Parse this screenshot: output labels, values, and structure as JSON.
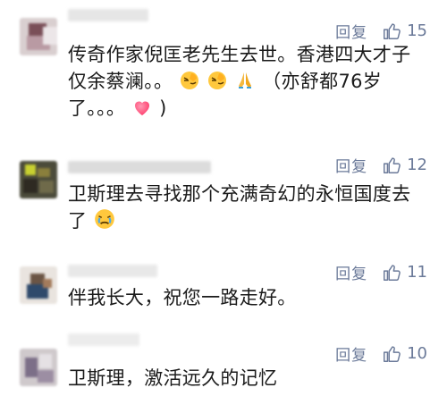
{
  "comments": [
    {
      "reply_label": "回复",
      "likes": "15",
      "text_lines": [
        "传奇作家倪匡老先生去世。香港四大才子",
        "仅余蔡澜。。",
        "（亦舒都76岁",
        "了。。。"
      ],
      "emoji_icons": [
        "facepalm-emoji",
        "facepalm-emoji",
        "praying-hands-emoji",
        "heart-emoji"
      ],
      "tail": ")"
    },
    {
      "reply_label": "回复",
      "likes": "12",
      "text_lines": [
        "卫斯理去寻找那个充满奇幻的永恒国度去",
        "了"
      ],
      "emoji_icons": [
        "crying-face-emoji"
      ]
    },
    {
      "reply_label": "回复",
      "likes": "11",
      "text_lines": [
        "伴我长大，祝您一路走好。"
      ]
    },
    {
      "reply_label": "回复",
      "likes": "10",
      "text_lines": [
        "卫斯理，激活远久的记忆"
      ]
    }
  ],
  "colors": {
    "action": "#6b7a99",
    "text": "#1a1a1a",
    "heart": "#ff3b6b",
    "emoji_yellow": "#ffc83d"
  }
}
